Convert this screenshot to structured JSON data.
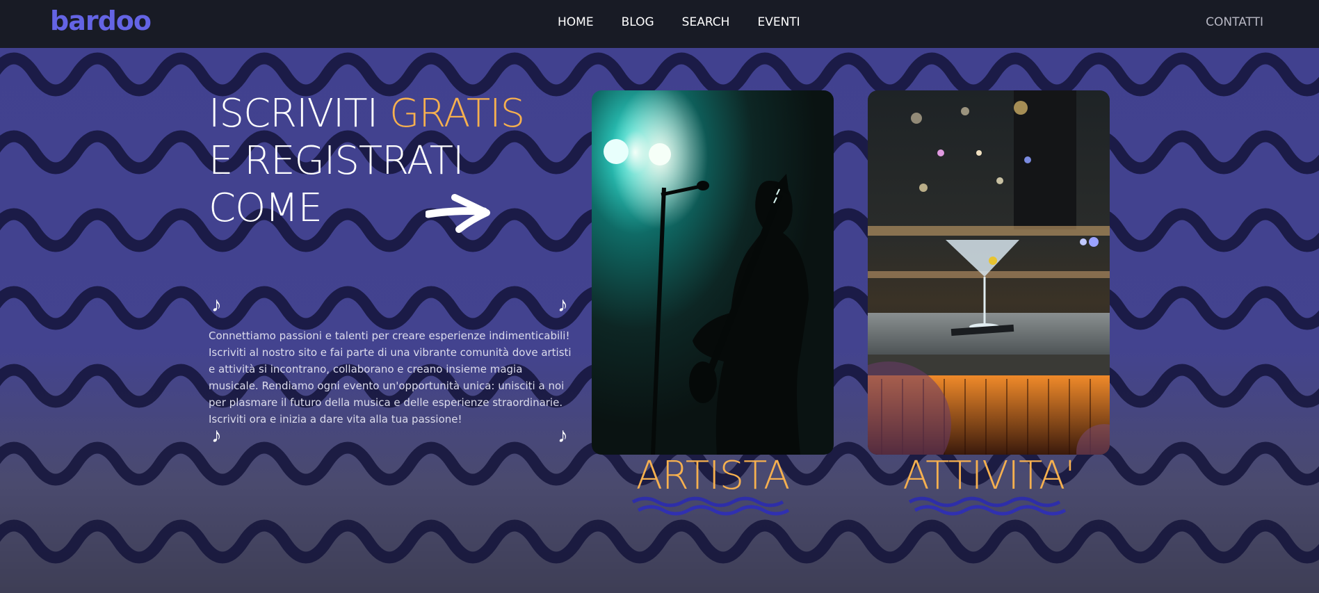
{
  "nav": {
    "logo": "bardoo",
    "items": [
      "HOME",
      "BLOG",
      "SEARCH",
      "EVENTI"
    ],
    "contact": "CONTATTI"
  },
  "hero": {
    "line1_a": "ISCRIVITI",
    "line1_b": "GRATIS",
    "line2": "E REGISTRATI",
    "line3": "COME",
    "description": "Connettiamo passioni e talenti per creare esperienze indimenticabili! Iscriviti al nostro sito e fai parte di una vibrante comunità dove artisti e attività si incontrano, collaborano e creano insieme magia musicale. Rendiamo ogni evento un'opportunità unica: unisciti a noi per plasmare il futuro della musica e delle esperienze straordinarie. Iscriviti ora e inizia a dare vita alla tua passione!",
    "note_glyph": "♪"
  },
  "cards": [
    {
      "label": "ARTISTA",
      "image": "guitarist-on-stage"
    },
    {
      "label": "ATTIVITA'",
      "image": "cocktail-bar-counter"
    }
  ],
  "colors": {
    "background": "#41418f",
    "nav": "#181b25",
    "logo": "#6464e4",
    "accent": "#f6b04f",
    "wave": "#14143a"
  }
}
